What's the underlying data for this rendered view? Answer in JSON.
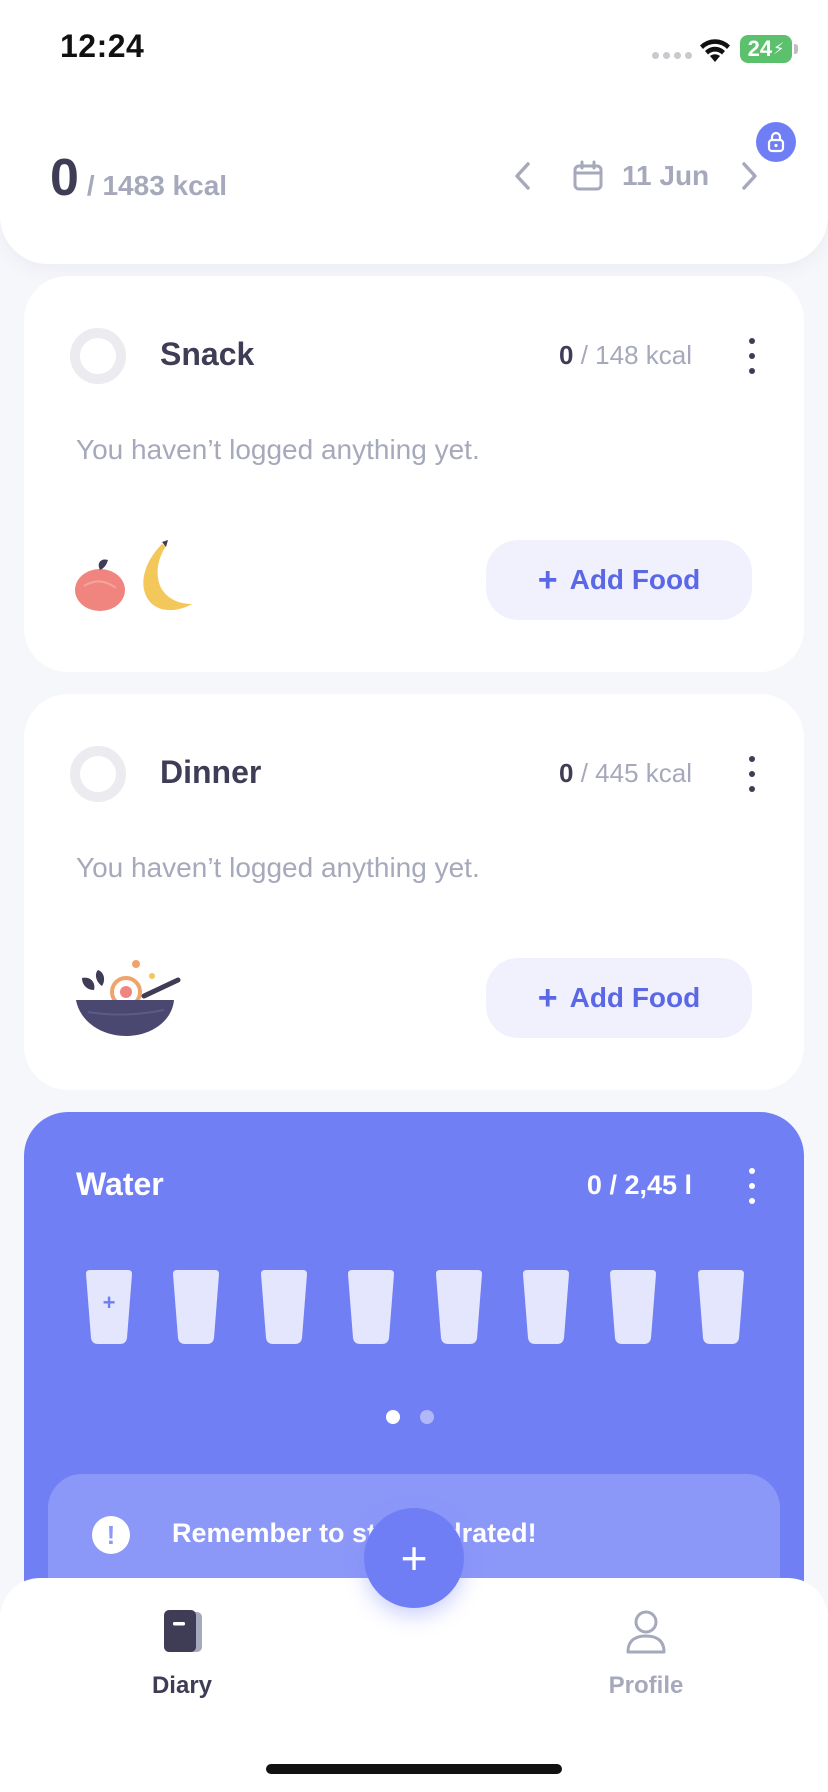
{
  "status_bar": {
    "time": "12:24",
    "battery": "24"
  },
  "header": {
    "kcal_consumed": "0",
    "kcal_total": "/ 1483 kcal",
    "date": "11 Jun",
    "prev_icon": "chevron-left-icon",
    "next_icon": "chevron-right-icon",
    "calendar_icon": "calendar-icon",
    "lock_icon": "lock-icon"
  },
  "meals": [
    {
      "title": "Snack",
      "kcal_consumed": "0",
      "kcal_goal": " / 148 kcal",
      "empty_text": "You haven’t logged anything yet.",
      "add_label": "Add Food",
      "art_icon": "apple-banana-icon"
    },
    {
      "title": "Dinner",
      "kcal_consumed": "0",
      "kcal_goal": " / 445 kcal",
      "empty_text": "You haven’t logged anything yet.",
      "add_label": "Add Food",
      "art_icon": "bowl-icon"
    }
  ],
  "water": {
    "title": "Water",
    "amount": "0 / 2,45 l",
    "glasses_filled": 0,
    "glasses_total": 8,
    "add_glass_symbol": "+",
    "page": 1,
    "pages": 2,
    "reminder": "Remember to stay hydrated!",
    "reminder_symbol": "!"
  },
  "tabbar": {
    "diary_label": "Diary",
    "profile_label": "Profile",
    "fab_symbol": "+"
  },
  "colors": {
    "accent": "#6f7ef5",
    "water_card": "#717ff5",
    "text_dark": "#3f3d56",
    "text_muted": "#a6a9bb"
  }
}
